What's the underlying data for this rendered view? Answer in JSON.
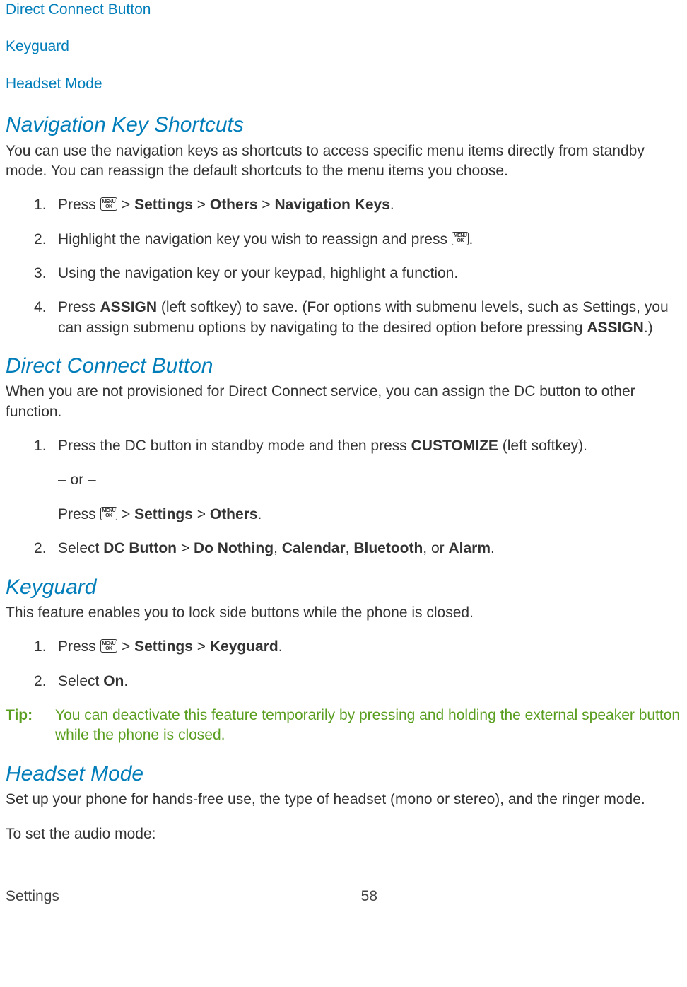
{
  "links": {
    "dcb": "Direct Connect Button",
    "keyguard": "Keyguard",
    "headset": "Headset Mode"
  },
  "nav": {
    "heading": "Navigation Key Shortcuts",
    "intro": "You can use the navigation keys as shortcuts to access specific menu items directly from standby mode. You can reassign the default shortcuts to the menu items you choose.",
    "step1_a": "Press ",
    "step1_b": " > ",
    "step1_settings": "Settings",
    "step1_c": " > ",
    "step1_others": "Others",
    "step1_d": " > ",
    "step1_navkeys": "Navigation Keys",
    "step1_e": ".",
    "step2_a": "Highlight the navigation key you wish to reassign and press ",
    "step2_b": ".",
    "step3": "Using the navigation key or your keypad, highlight a function.",
    "step4_a": "Press ",
    "step4_assign": "ASSIGN",
    "step4_b": " (left softkey) to save. (For options with submenu levels, such as Settings, you can assign submenu options by navigating to the desired option before pressing ",
    "step4_assign2": "ASSIGN",
    "step4_c": ".)"
  },
  "dcb": {
    "heading": "Direct Connect Button",
    "intro": "When you are not provisioned for Direct Connect service, you can assign the DC button to other function.",
    "step1_a": "Press the DC button in standby mode and then press ",
    "step1_customize": "CUSTOMIZE",
    "step1_b": " (left softkey).",
    "or": "– or –",
    "step1_c": "Press ",
    "step1_d": " > ",
    "step1_settings": "Settings",
    "step1_e": " > ",
    "step1_others": "Others",
    "step1_f": ".",
    "step2_a": "Select ",
    "step2_dcbutton": "DC Button",
    "step2_b": " > ",
    "step2_donothing": "Do Nothing",
    "step2_c": ", ",
    "step2_calendar": "Calendar",
    "step2_d": ", ",
    "step2_bluetooth": "Bluetooth",
    "step2_e": ", or ",
    "step2_alarm": "Alarm",
    "step2_f": "."
  },
  "keyguard": {
    "heading": "Keyguard",
    "intro": "This feature enables you to lock side buttons while the phone is closed.",
    "step1_a": "Press ",
    "step1_b": " > ",
    "step1_settings": "Settings",
    "step1_c": " > ",
    "step1_keyguard": "Keyguard",
    "step1_d": ".",
    "step2_a": "Select ",
    "step2_on": "On",
    "step2_b": ".",
    "tip_label": "Tip:",
    "tip_text": "You can deactivate this feature temporarily by pressing and holding the external speaker button while the phone is closed."
  },
  "headset": {
    "heading": "Headset Mode",
    "intro": "Set up your phone for hands-free use, the type of headset (mono or stereo), and the ringer mode.",
    "subhead": "To set the audio mode:"
  },
  "footer": {
    "section": "Settings",
    "page": "58"
  },
  "icon": {
    "top": "MENU",
    "bot": "OK"
  }
}
